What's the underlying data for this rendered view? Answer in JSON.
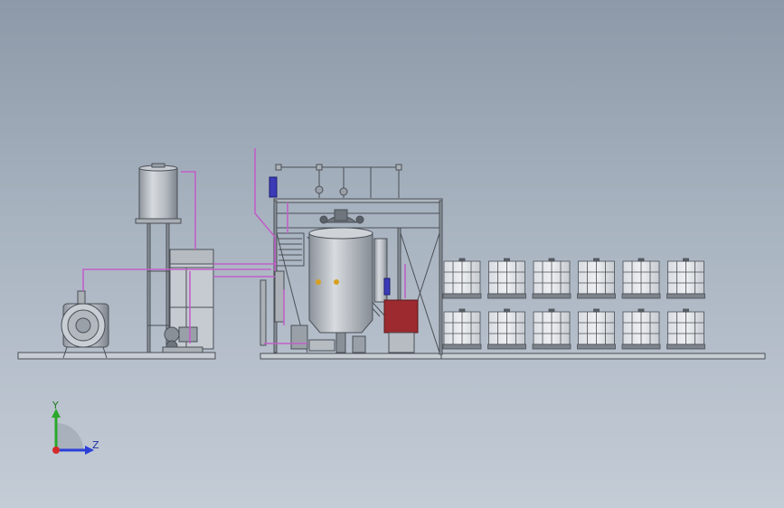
{
  "view": {
    "background_top": "#8d99a8",
    "background_bottom": "#c4ccd6"
  },
  "triad": {
    "y_label": "Y",
    "z_label": "Z",
    "y_color": "#2ba82b",
    "z_color": "#2a3fd8",
    "x_color": "#d42a2a"
  },
  "colors": {
    "steel": "#4a4f56",
    "tank_body": "#b9bec5",
    "pipe_magenta": "#c060c8",
    "motor_blue": "#3b3bb8",
    "panel_red": "#9c2a2f"
  },
  "ibc_rack": {
    "rows": 2,
    "columns": 6
  }
}
